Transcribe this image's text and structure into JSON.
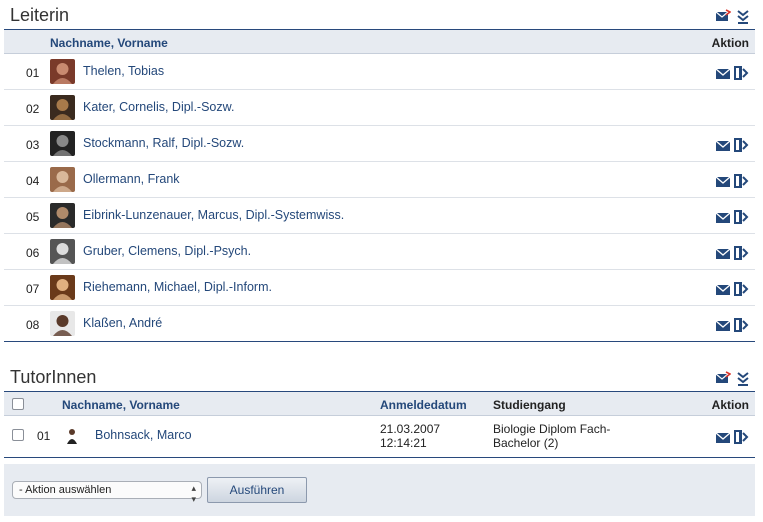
{
  "leiterin": {
    "title": "Leiterin",
    "col_name": "Nachname, Vorname",
    "col_action": "Aktion",
    "rows": [
      {
        "num": "01",
        "name": "Thelen, Tobias",
        "has_actions": true
      },
      {
        "num": "02",
        "name": "Kater, Cornelis, Dipl.-Sozw.",
        "has_actions": false
      },
      {
        "num": "03",
        "name": "Stockmann, Ralf, Dipl.-Sozw.",
        "has_actions": true
      },
      {
        "num": "04",
        "name": "Ollermann, Frank",
        "has_actions": true
      },
      {
        "num": "05",
        "name": "Eibrink-Lunzenauer, Marcus, Dipl.-Systemwiss.",
        "has_actions": true
      },
      {
        "num": "06",
        "name": "Gruber, Clemens, Dipl.-Psych.",
        "has_actions": true
      },
      {
        "num": "07",
        "name": "Riehemann, Michael, Dipl.-Inform.",
        "has_actions": true
      },
      {
        "num": "08",
        "name": "Klaßen, André",
        "has_actions": true
      }
    ]
  },
  "tutorinnen": {
    "title": "TutorInnen",
    "col_name": "Nachname, Vorname",
    "col_date": "Anmeldedatum",
    "col_study": "Studiengang",
    "col_action": "Aktion",
    "rows": [
      {
        "num": "01",
        "name": "Bohnsack, Marco",
        "date_line1": "21.03.2007",
        "date_line2": "12:14:21",
        "study_line1": "Biologie Diplom Fach-",
        "study_line2": "Bachelor (2)"
      }
    ]
  },
  "footer": {
    "select_value": "- Aktion auswählen",
    "execute_label": "Ausführen"
  },
  "colors": {
    "link": "#24487a",
    "accent_line": "#28497c",
    "header_bg": "#e7ebf1"
  },
  "icons": {
    "mail": "mail-icon",
    "profile": "profile-arrow-icon",
    "mail_all": "mail-all-icon",
    "export": "export-icon"
  }
}
